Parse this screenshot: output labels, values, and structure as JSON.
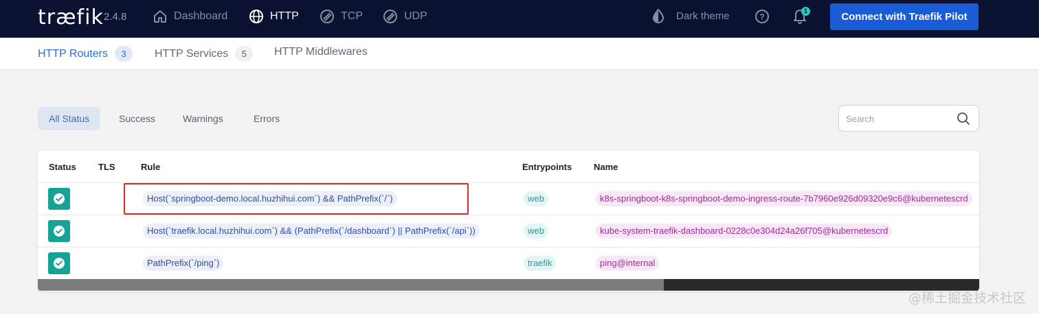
{
  "header": {
    "logo": "træfik",
    "version": "2.4.8",
    "nav": [
      {
        "label": "Dashboard",
        "icon": "home-icon"
      },
      {
        "label": "HTTP",
        "icon": "globe-icon"
      },
      {
        "label": "TCP",
        "icon": "tcp-icon"
      },
      {
        "label": "UDP",
        "icon": "udp-icon"
      }
    ],
    "theme_label": "Dark theme",
    "notification_count": "1",
    "pilot_button": "Connect with Traefik Pilot"
  },
  "subnav": {
    "tabs": [
      {
        "label": "HTTP Routers",
        "count": "3"
      },
      {
        "label": "HTTP Services",
        "count": "5"
      },
      {
        "label": "HTTP Middlewares"
      }
    ]
  },
  "filters": [
    "All Status",
    "Success",
    "Warnings",
    "Errors"
  ],
  "search": {
    "placeholder": "Search"
  },
  "table": {
    "headers": [
      "Status",
      "TLS",
      "Rule",
      "Entrypoints",
      "Name"
    ],
    "rows": [
      {
        "rule": "Host(`springboot-demo.local.huzhihui.com`) && PathPrefix(`/`)",
        "entrypoint": "web",
        "name": "k8s-springboot-k8s-springboot-demo-ingress-route-7b7960e926d09320e9c6@kubernetescrd"
      },
      {
        "rule": "Host(`traefik.local.huzhihui.com`) && (PathPrefix(`/dashboard`) || PathPrefix(`/api`))",
        "entrypoint": "web",
        "name": "kube-system-traefik-dashboard-0228c0e304d24a26f705@kubernetescrd"
      },
      {
        "rule": "PathPrefix(`/ping`)",
        "entrypoint": "traefik",
        "name": "ping@internal"
      }
    ]
  },
  "watermark": "@稀土掘金技术社区",
  "colors": {
    "navbar": "#0a1131",
    "accent": "#1a5cd6",
    "success": "#14a394",
    "highlight": "#e0262b"
  }
}
